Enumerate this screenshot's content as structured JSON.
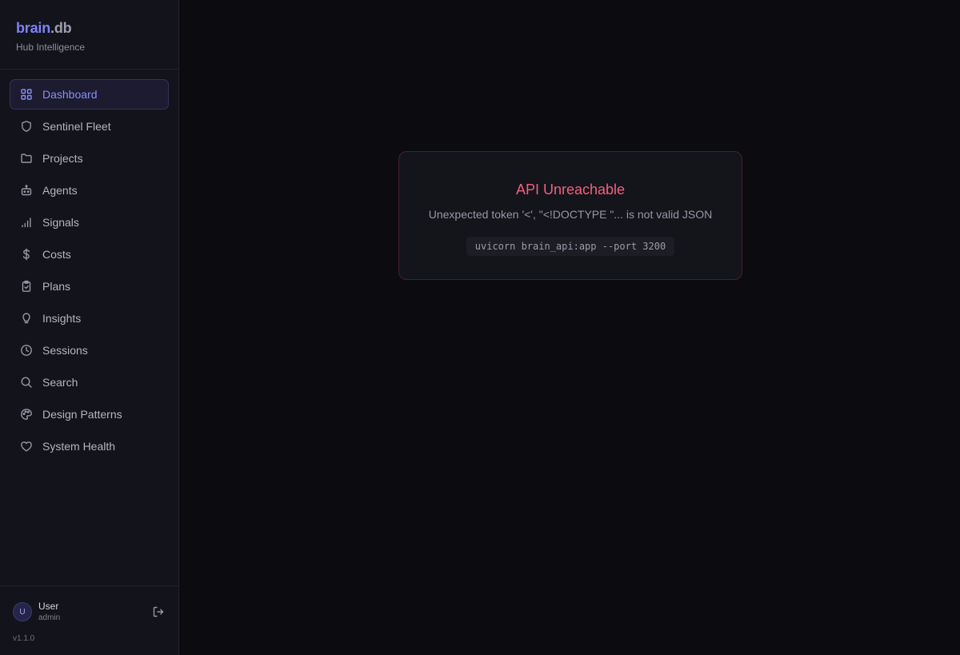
{
  "brand": {
    "name_primary": "brain",
    "name_secondary": ".db",
    "tagline": "Hub Intelligence"
  },
  "nav": {
    "items": [
      {
        "label": "Dashboard",
        "icon": "grid-icon",
        "active": true
      },
      {
        "label": "Sentinel Fleet",
        "icon": "shield-icon"
      },
      {
        "label": "Projects",
        "icon": "folder-icon"
      },
      {
        "label": "Agents",
        "icon": "robot-icon"
      },
      {
        "label": "Signals",
        "icon": "signal-bars-icon"
      },
      {
        "label": "Costs",
        "icon": "dollar-icon"
      },
      {
        "label": "Plans",
        "icon": "clipboard-check-icon"
      },
      {
        "label": "Insights",
        "icon": "lightbulb-icon"
      },
      {
        "label": "Sessions",
        "icon": "clock-icon"
      },
      {
        "label": "Search",
        "icon": "search-icon"
      },
      {
        "label": "Design Patterns",
        "icon": "palette-icon"
      },
      {
        "label": "System Health",
        "icon": "heart-icon"
      }
    ]
  },
  "user": {
    "initial": "U",
    "name": "User",
    "role": "admin"
  },
  "version": "v1.1.0",
  "error": {
    "title": "API Unreachable",
    "message": "Unexpected token '<', \"<!DOCTYPE \"... is not valid JSON",
    "command": "uvicorn brain_api:app --port 3200"
  },
  "colors": {
    "accent": "#8a8df8",
    "error": "#f0617f",
    "background": "#0b0b10",
    "sidebar": "#13131b"
  }
}
